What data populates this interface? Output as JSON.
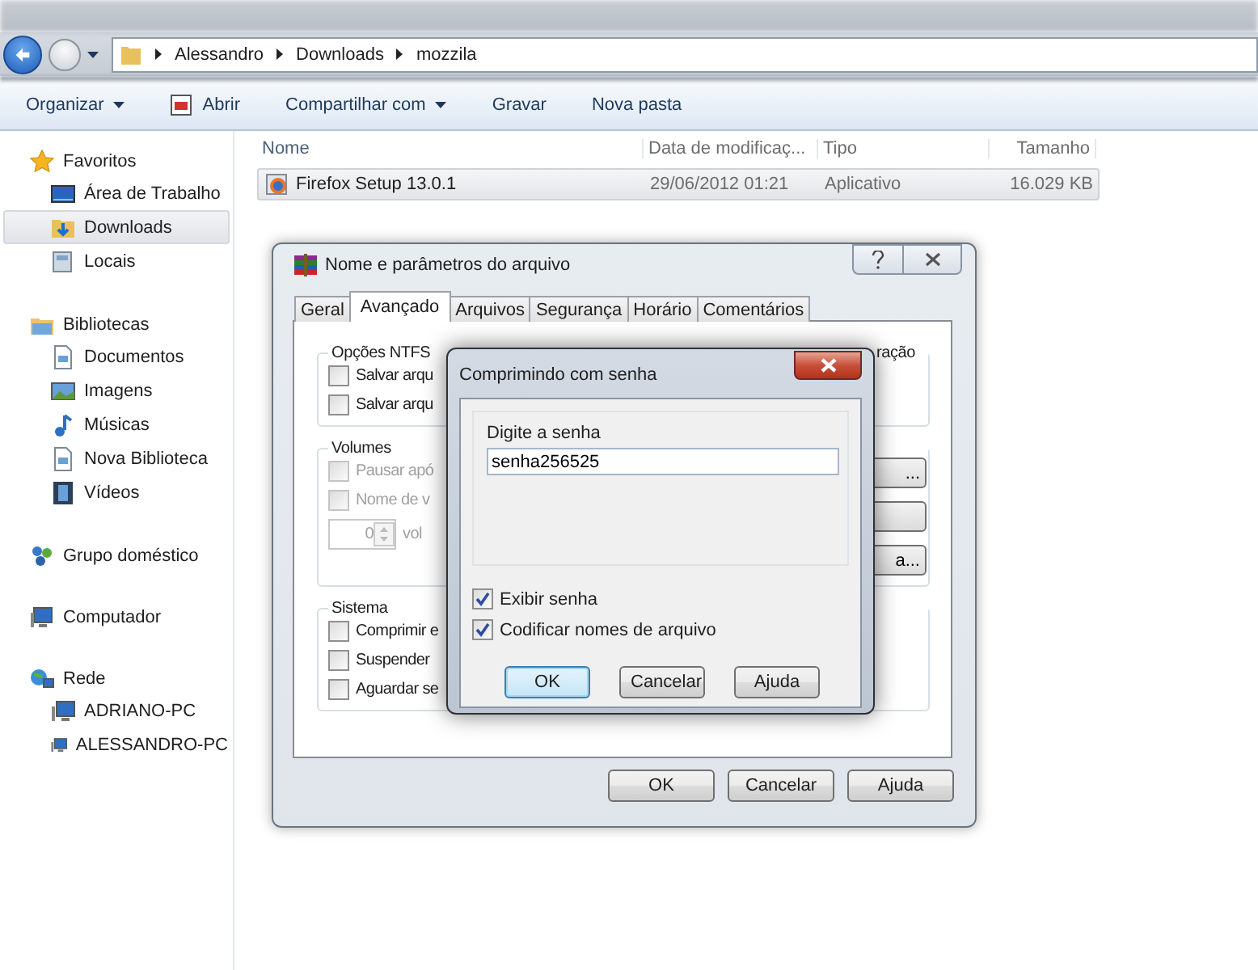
{
  "address_bar": {
    "breadcrumb": [
      "Alessandro",
      "Downloads",
      "mozzila"
    ]
  },
  "toolbar": [
    {
      "label": "Organizar",
      "kind": "menu"
    },
    {
      "label": "Abrir",
      "kind": "icon"
    },
    {
      "label": "Compartilhar com",
      "kind": "menu"
    },
    {
      "label": "Gravar",
      "kind": "plain"
    },
    {
      "label": "Nova pasta",
      "kind": "plain"
    }
  ],
  "sidebar": {
    "groups": [
      {
        "label": "Favoritos",
        "children": [
          {
            "label": "Área de Trabalho",
            "selected": false
          },
          {
            "label": "Downloads",
            "selected": true
          },
          {
            "label": "Locais",
            "selected": false
          }
        ]
      },
      {
        "label": "Bibliotecas",
        "children": [
          {
            "label": "Documentos",
            "selected": false
          },
          {
            "label": "Imagens",
            "selected": false
          },
          {
            "label": "Músicas",
            "selected": false
          },
          {
            "label": "Nova Biblioteca",
            "selected": false
          },
          {
            "label": "Vídeos",
            "selected": false
          }
        ]
      },
      {
        "label": "Grupo doméstico"
      },
      {
        "label": "Computador"
      },
      {
        "label": "Rede",
        "children": [
          {
            "label": "ADRIANO-PC",
            "selected": false
          },
          {
            "label": "ALESSANDRO-PC",
            "selected": false
          }
        ]
      }
    ]
  },
  "file_list": {
    "columns": [
      "Nome",
      "Data de modificaç...",
      "Tipo",
      "Tamanho"
    ],
    "rows": [
      {
        "name": "Firefox Setup 13.0.1",
        "date": "29/06/2012 01:21",
        "type": "Aplicativo",
        "size": "16.029 KB",
        "selected": true
      }
    ]
  },
  "archive_dialog": {
    "title": "Nome e parâmetros do arquivo",
    "tabs": [
      {
        "label": "Geral",
        "selected": false
      },
      {
        "label": "Avançado",
        "selected": true
      },
      {
        "label": "Arquivos",
        "selected": false
      },
      {
        "label": "Segurança",
        "selected": false
      },
      {
        "label": "Horário",
        "selected": false
      },
      {
        "label": "Comentários",
        "selected": false
      }
    ],
    "groups": [
      {
        "label": "Opções NTFS",
        "side_label": "ração",
        "options": [
          {
            "kind": "checkbox",
            "label": "Salvar arqu",
            "checked": false,
            "disabled": false
          },
          {
            "kind": "checkbox",
            "label": "Salvar arqu",
            "checked": false,
            "disabled": false
          }
        ]
      },
      {
        "label": "Volumes",
        "options": [
          {
            "kind": "checkbox",
            "label": "Pausar apó",
            "checked": false,
            "disabled": true
          },
          {
            "kind": "checkbox",
            "label": "Nome de v",
            "checked": false,
            "disabled": true
          },
          {
            "kind": "spinner",
            "value": "0",
            "unit": "vol",
            "disabled": true
          }
        ],
        "side_buttons": [
          {
            "kind": "text",
            "label": "..."
          },
          {
            "kind": "blank"
          },
          {
            "kind": "text",
            "label": "a..."
          }
        ]
      },
      {
        "label": "Sistema",
        "options": [
          {
            "kind": "checkbox",
            "label": "Comprimir e",
            "checked": false,
            "disabled": false
          },
          {
            "kind": "checkbox",
            "label": "Suspender",
            "checked": false,
            "disabled": false
          },
          {
            "kind": "checkbox",
            "label": "Aguardar se",
            "checked": false,
            "disabled": false
          }
        ]
      }
    ],
    "buttons": [
      "OK",
      "Cancelar",
      "Ajuda"
    ]
  },
  "password_dialog": {
    "title": "Comprimindo com senha",
    "field": {
      "label": "Digite a senha",
      "value": "senha256525"
    },
    "options": [
      {
        "label": "Exibir senha",
        "checked": true
      },
      {
        "label": "Codificar nomes de arquivo",
        "checked": true
      }
    ],
    "buttons": [
      {
        "label": "OK",
        "focused": true
      },
      {
        "label": "Cancelar",
        "focused": false
      },
      {
        "label": "Ajuda",
        "focused": false
      }
    ]
  }
}
